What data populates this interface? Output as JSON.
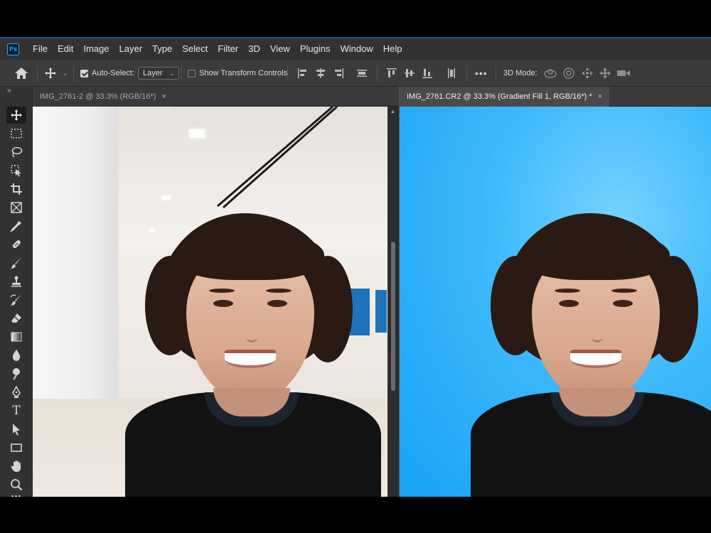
{
  "app": {
    "logo": "Ps",
    "menu": [
      "File",
      "Edit",
      "Image",
      "Layer",
      "Type",
      "Select",
      "Filter",
      "3D",
      "View",
      "Plugins",
      "Window",
      "Help"
    ]
  },
  "options_bar": {
    "auto_select_label": "Auto-Select:",
    "auto_select_checked": true,
    "layer_select_value": "Layer",
    "show_transform_label": "Show Transform Controls",
    "show_transform_checked": false,
    "more": "•••",
    "mode_3d_label": "3D Mode:"
  },
  "toolbar": {
    "collapse": "»",
    "tools": [
      "move-tool",
      "rectangular-marquee-tool",
      "lasso-tool",
      "object-selection-tool",
      "crop-tool",
      "frame-tool",
      "eyedropper-tool",
      "spot-healing-tool",
      "brush-tool",
      "clone-stamp-tool",
      "history-brush-tool",
      "eraser-tool",
      "gradient-tool",
      "blur-tool",
      "dodge-tool",
      "pen-tool",
      "type-tool",
      "path-selection-tool",
      "rectangle-tool",
      "hand-tool",
      "zoom-tool",
      "more-tools"
    ],
    "type_glyph": "T",
    "more_glyph": "•••"
  },
  "documents": [
    {
      "title": "IMG_2761-2 @ 33.3% (RGB/16*)",
      "active": false,
      "close": "×"
    },
    {
      "title": "IMG_2761.CR2 @ 33.3% (Gradient Fill 1, RGB/16*) *",
      "active": true,
      "close": "×"
    }
  ],
  "colors": {
    "accent_border": "#1d4fa7",
    "gradient_fill": "#2aaefa",
    "ui_dark": "#323232"
  }
}
